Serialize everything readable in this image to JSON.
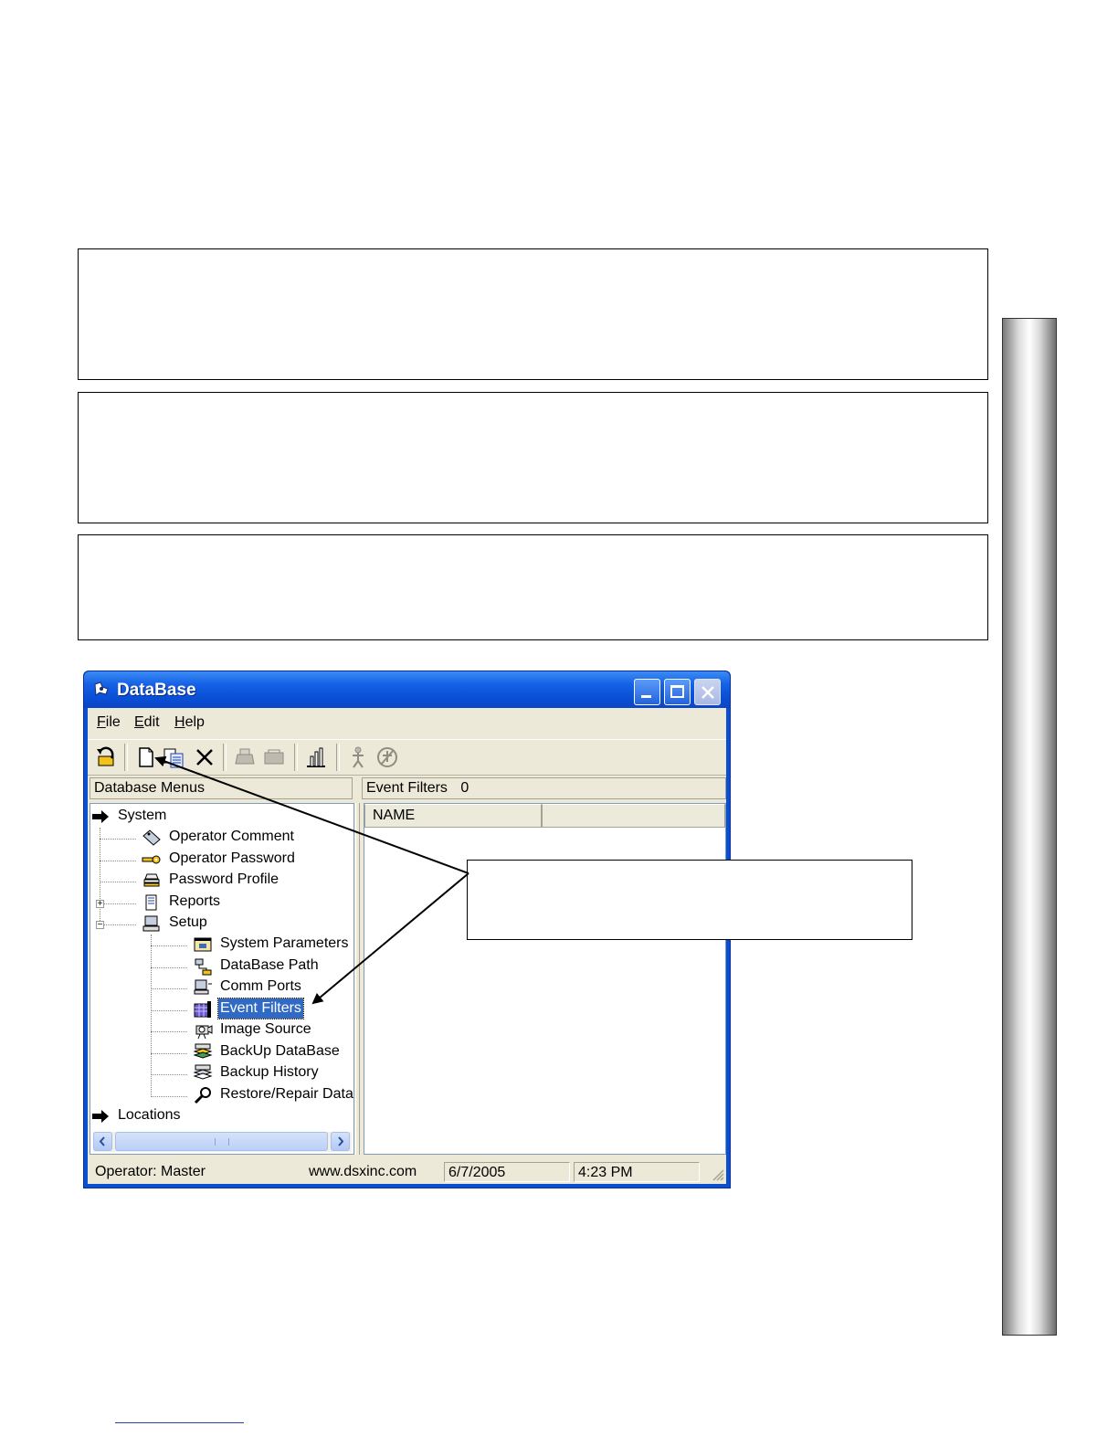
{
  "window": {
    "title": "DataBase",
    "menu": [
      "File",
      "Edit",
      "Help"
    ],
    "menu_underline": [
      "F",
      "E",
      "H"
    ]
  },
  "toolbar": {
    "buttons": [
      "exit-icon",
      "new-icon",
      "copy-icon",
      "delete-icon",
      "print-icon",
      "print-preview-icon",
      "chart-icon",
      "user-icon",
      "user-clear-icon"
    ]
  },
  "left_pane": {
    "header": "Database Menus",
    "tree": {
      "system": "System",
      "operator_comment": "Operator Comment",
      "operator_password": "Operator Password",
      "password_profile": "Password Profile",
      "reports": "Reports",
      "setup": "Setup",
      "system_parameters": "System Parameters",
      "database_path": "DataBase Path",
      "comm_ports": "Comm Ports",
      "event_filters": "Event Filters",
      "image_source": "Image Source",
      "backup_database": "BackUp DataBase",
      "backup_history": "Backup History",
      "restore_repair": "Restore/Repair Data",
      "locations": "Locations"
    },
    "selected": "Event Filters"
  },
  "right_pane": {
    "header_label": "Event Filters",
    "header_count": "0",
    "columns": [
      "NAME",
      ""
    ]
  },
  "statusbar": {
    "operator": "Operator:  Master",
    "website": "www.dsxinc.com",
    "date": "6/7/2005",
    "time": "4:23 PM"
  },
  "colors": {
    "titlebar": "#0a50d8",
    "selection": "#316ac5",
    "window_bg": "#ece9d8"
  }
}
